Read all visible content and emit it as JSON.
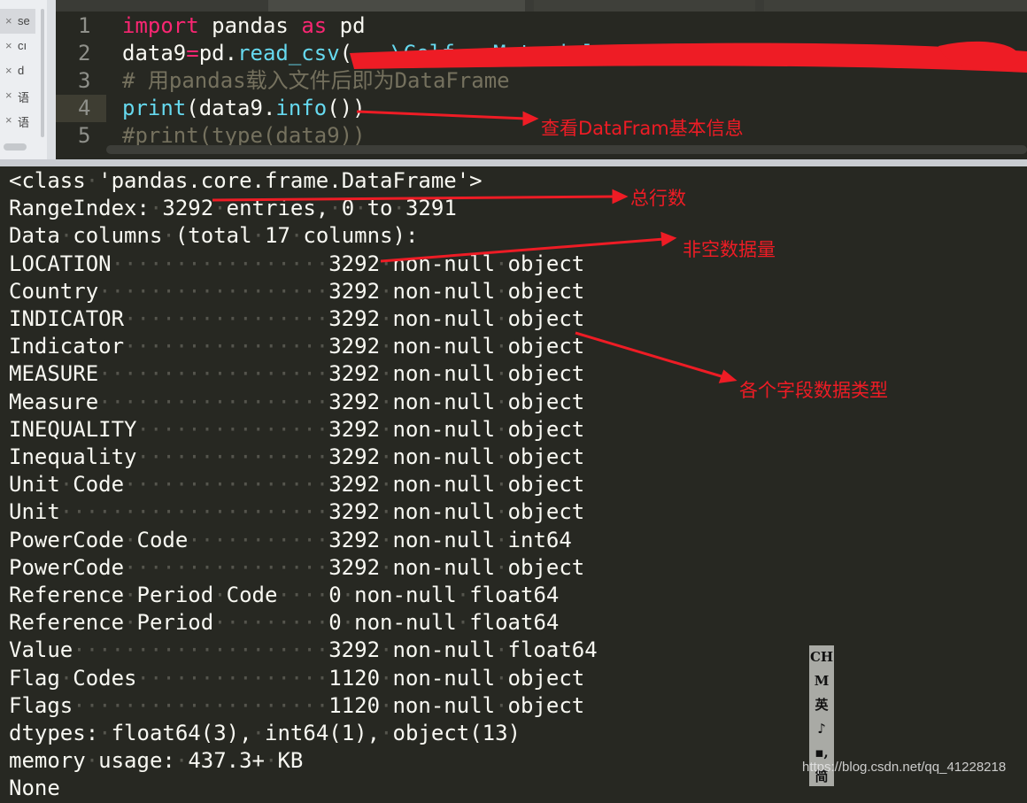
{
  "sidebar": {
    "items": [
      {
        "label": "se"
      },
      {
        "label": "cı"
      },
      {
        "label": "d"
      },
      {
        "label": "语"
      },
      {
        "label": "语"
      }
    ],
    "close_glyph": "×"
  },
  "editor": {
    "line_numbers": [
      "1",
      "2",
      "3",
      "4",
      "5"
    ],
    "lines": [
      {
        "parts": [
          {
            "t": "import",
            "c": "kw"
          },
          {
            "t": " ",
            "c": "dt"
          },
          {
            "t": "pandas",
            "c": ""
          },
          {
            "t": " ",
            "c": "dt"
          },
          {
            "t": "as",
            "c": "kw"
          },
          {
            "t": " ",
            "c": "dt"
          },
          {
            "t": "pd",
            "c": ""
          }
        ]
      },
      {
        "parts": [
          {
            "t": "data9",
            "c": ""
          },
          {
            "t": "=",
            "c": "kw"
          },
          {
            "t": "pd.",
            "c": ""
          },
          {
            "t": "read_csv",
            "c": "fn"
          },
          {
            "t": "(",
            "c": ""
          },
          {
            "t": "...\\Golf...Materials\\technologyhe...",
            "c": "fn"
          }
        ]
      },
      {
        "parts": [
          {
            "t": "# 用pandas载入文件后即为DataFrame",
            "c": "cm"
          }
        ]
      },
      {
        "parts": [
          {
            "t": "print",
            "c": "fn"
          },
          {
            "t": "(data9.",
            "c": ""
          },
          {
            "t": "info",
            "c": "fn"
          },
          {
            "t": "())",
            "c": ""
          }
        ]
      },
      {
        "parts": [
          {
            "t": "#print(type(data9))",
            "c": "cm"
          }
        ]
      }
    ]
  },
  "output": {
    "header": [
      "<class 'pandas.core.frame.DataFrame'>",
      "RangeIndex: 3292 entries, 0 to 3291",
      "Data columns (total 17 columns):"
    ],
    "columns": [
      {
        "name": "LOCATION",
        "count": "3292",
        "dtype": "object"
      },
      {
        "name": "Country",
        "count": "3292",
        "dtype": "object"
      },
      {
        "name": "INDICATOR",
        "count": "3292",
        "dtype": "object"
      },
      {
        "name": "Indicator",
        "count": "3292",
        "dtype": "object"
      },
      {
        "name": "MEASURE",
        "count": "3292",
        "dtype": "object"
      },
      {
        "name": "Measure",
        "count": "3292",
        "dtype": "object"
      },
      {
        "name": "INEQUALITY",
        "count": "3292",
        "dtype": "object"
      },
      {
        "name": "Inequality",
        "count": "3292",
        "dtype": "object"
      },
      {
        "name": "Unit Code",
        "count": "3292",
        "dtype": "object"
      },
      {
        "name": "Unit",
        "count": "3292",
        "dtype": "object"
      },
      {
        "name": "PowerCode Code",
        "count": "3292",
        "dtype": "int64"
      },
      {
        "name": "PowerCode",
        "count": "3292",
        "dtype": "object"
      },
      {
        "name": "Reference Period Code",
        "count": "0",
        "dtype": "float64"
      },
      {
        "name": "Reference Period",
        "count": "0",
        "dtype": "float64"
      },
      {
        "name": "Value",
        "count": "3292",
        "dtype": "float64"
      },
      {
        "name": "Flag Codes",
        "count": "1120",
        "dtype": "object"
      },
      {
        "name": "Flags",
        "count": "1120",
        "dtype": "object"
      }
    ],
    "footer": [
      "dtypes: float64(3), int64(1), object(13)",
      "memory usage: 437.3+ KB",
      "None"
    ]
  },
  "annotations": {
    "info": "查看DataFram基本信息",
    "rows": "总行数",
    "nonnull": "非空数据量",
    "dtypes": "各个字段数据类型",
    "color": "#ee1c25"
  },
  "ime": {
    "items": [
      "CH",
      "M",
      "英",
      "♪",
      "▪,",
      "简"
    ]
  },
  "watermark": "https://blog.csdn.net/qq_41228218",
  "colors": {
    "background": "#272822",
    "keyword": "#f92672",
    "function": "#66d9ef",
    "comment": "#75715e",
    "text": "#f8f8f2"
  }
}
